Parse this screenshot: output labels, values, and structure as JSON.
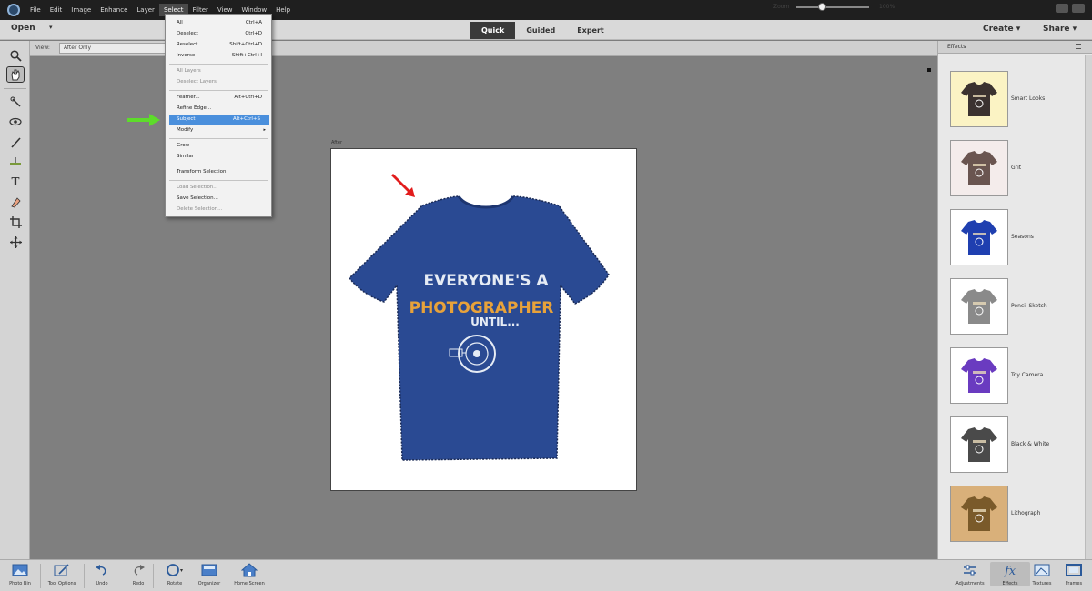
{
  "menu": [
    "File",
    "Edit",
    "Image",
    "Enhance",
    "Layer",
    "Select",
    "Filter",
    "View",
    "Window",
    "Help"
  ],
  "menu_active": "Select",
  "modebar": {
    "open": "Open",
    "tabs": [
      "Quick",
      "Guided",
      "Expert"
    ],
    "active_tab": "Quick",
    "create": "Create",
    "share": "Share"
  },
  "options": {
    "view_label": "View:",
    "view_value": "After Only",
    "zoom_label": "Zoom",
    "zoom_value": "100%",
    "zoom_level": 0.35
  },
  "document": {
    "label": "After"
  },
  "select_menu": [
    {
      "label": "All",
      "shortcut": "Ctrl+A"
    },
    {
      "label": "Deselect",
      "shortcut": "Ctrl+D"
    },
    {
      "label": "Reselect",
      "shortcut": "Shift+Ctrl+D"
    },
    {
      "label": "Inverse",
      "shortcut": "Shift+Ctrl+I"
    },
    {
      "sep": true
    },
    {
      "label": "All Layers",
      "disabled": true
    },
    {
      "label": "Deselect Layers",
      "disabled": true
    },
    {
      "sep": true
    },
    {
      "label": "Feather...",
      "shortcut": "Alt+Ctrl+D"
    },
    {
      "label": "Refine Edge..."
    },
    {
      "label": "Subject",
      "shortcut": "Alt+Ctrl+S",
      "highlight": true
    },
    {
      "label": "Modify",
      "submenu": true
    },
    {
      "sep": true
    },
    {
      "label": "Grow"
    },
    {
      "label": "Similar"
    },
    {
      "sep": true
    },
    {
      "label": "Transform Selection"
    },
    {
      "sep": true
    },
    {
      "label": "Load Selection...",
      "disabled": true
    },
    {
      "label": "Save Selection..."
    },
    {
      "label": "Delete Selection...",
      "disabled": true
    }
  ],
  "effects_panel": {
    "title": "Effects",
    "items": [
      {
        "label": "Smart Looks",
        "bg": "#fbf3c4",
        "shirt": "#3b3230"
      },
      {
        "label": "Grit",
        "bg": "#f4eceb",
        "shirt": "#6a5550"
      },
      {
        "label": "Seasons",
        "bg": "#ffffff",
        "shirt": "#1f3fb0"
      },
      {
        "label": "Pencil Sketch",
        "bg": "#ffffff",
        "shirt": "#8a8a8a"
      },
      {
        "label": "Toy Camera",
        "bg": "#ffffff",
        "shirt": "#6a3bc0"
      },
      {
        "label": "Black & White",
        "bg": "#ffffff",
        "shirt": "#4a4a4a"
      },
      {
        "label": "Lithograph",
        "bg": "#d9b07a",
        "shirt": "#7a5a2a"
      }
    ]
  },
  "bottom_left": [
    {
      "label": "Photo Bin",
      "icon": "photo-bin-icon"
    },
    {
      "label": "Tool Options",
      "icon": "tool-options-icon"
    },
    {
      "label": "Undo",
      "icon": "undo-icon"
    },
    {
      "label": "Redo",
      "icon": "redo-icon"
    },
    {
      "label": "Rotate",
      "icon": "rotate-icon"
    },
    {
      "label": "Organizer",
      "icon": "organizer-icon"
    },
    {
      "label": "Home Screen",
      "icon": "home-icon"
    }
  ],
  "bottom_right": [
    {
      "label": "Adjustments",
      "icon": "adjustments-icon"
    },
    {
      "label": "Effects",
      "icon": "effects-icon"
    },
    {
      "label": "Textures",
      "icon": "textures-icon"
    },
    {
      "label": "Frames",
      "icon": "frames-icon"
    }
  ],
  "shirt": {
    "color": "#2a4a93",
    "line1": "EVERYONE'S A",
    "line2": "PHOTOGRAPHER",
    "line3": "UNTIL...",
    "accent": "#e8a23a"
  }
}
